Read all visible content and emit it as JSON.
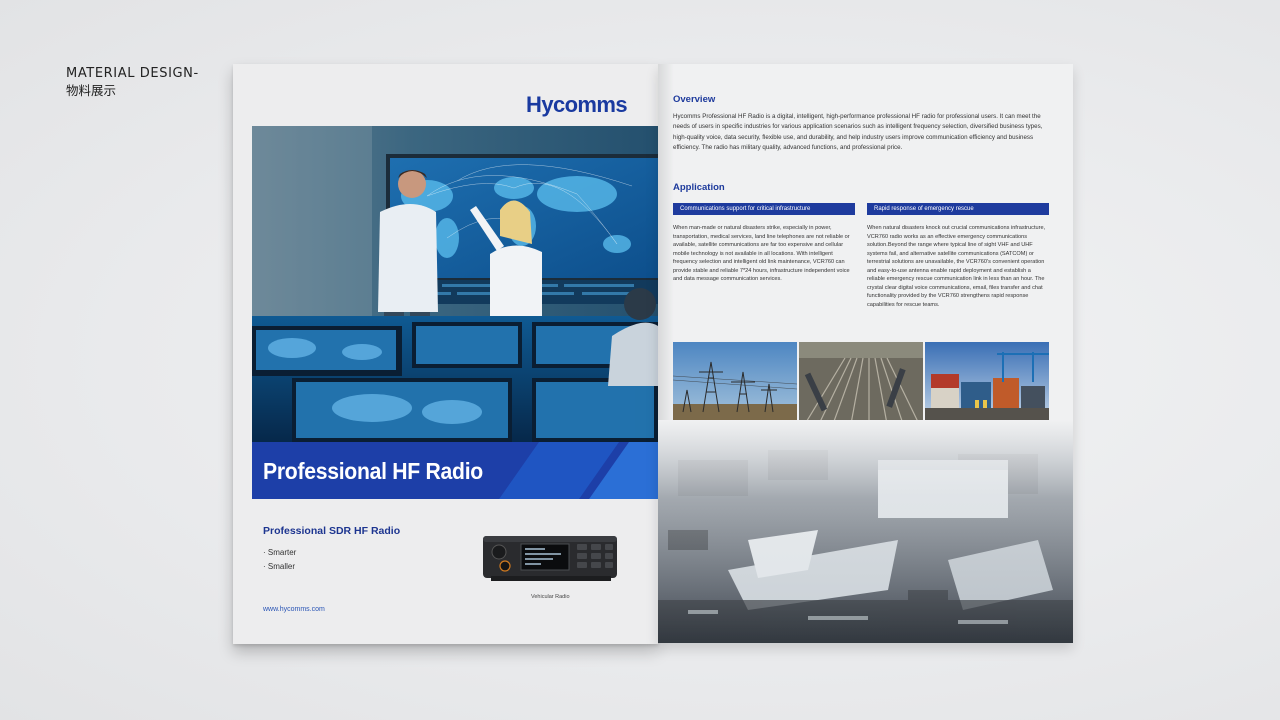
{
  "corner_label": {
    "line1": "MATERIAL DESIGN-",
    "line2": "物料展示"
  },
  "cover": {
    "logo": "Hycomms",
    "title": "Professional HF Radio",
    "subtitle": "Professional SDR HF Radio",
    "features": [
      "Smarter",
      "Smaller"
    ],
    "radio_caption": "Vehicular Radio",
    "website": "www.hycomms.com"
  },
  "right_page": {
    "overview_heading": "Overview",
    "overview_text": "Hycomms Professional HF Radio is a digital, intelligent, high-performance professional HF radio for professional users. It can meet the needs of users in specific industries for various application scenarios such as intelligent frequency selection, diversified business types, high-quality voice, data security, flexible use, and durability, and help industry users improve communication efficiency and business  efficiency. The radio has military quality, advanced functions, and professional price.",
    "application_heading": "Application",
    "applications": [
      {
        "tab": "Communications support for critical infrastructure",
        "text": "When man-made or natural disasters strike, especially in power, transportation, medical services, land line telephones are not reliable or available, satellite communications are far too expensive and cellular mobile technology is not available in all locations. With intelligent frequency selection and intelligent old link maintenance, VCR760 can provide stable and reliable 7*24 hours, infrastructure independent voice and data message communication services."
      },
      {
        "tab": "Rapid response of emergency rescue",
        "text": "When natural disasters knock out crucial communications infrastructure, VCR760 radio works as an effective emergency communications solution.Beyond the range where typical line of sight VHF and UHF systems fail, and alternative satellite communications (SATCOM) or terrestrial solutions are unavailable, the VCR760's convenient operation  and easy-to-use antenna enable rapid deployment and establish a reliable emergency rescue communication link in less than an hour. The crystal clear digital voice communications, email, files transfer and chat functionality provided by the VCR760 strengthens rapid response capabilities for rescue teams."
      }
    ]
  },
  "colors": {
    "brand_blue": "#1d3fa8",
    "heading_blue": "#1d3a9c",
    "page_bg": "#ededee"
  }
}
